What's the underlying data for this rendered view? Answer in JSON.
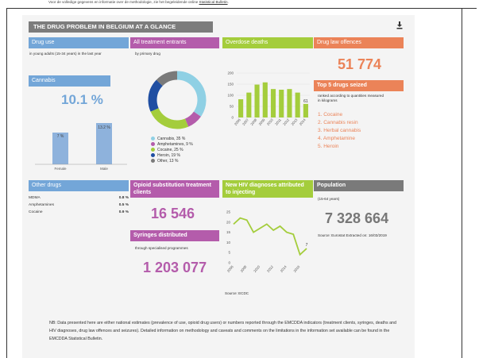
{
  "top_note": {
    "text": "Voor de volledige gegevens en informatie over de methodologie, zie het begeleidende online",
    "link": "Statistical Bulletin",
    "end": "."
  },
  "title": "THE DRUG PROBLEM IN BELGIUM AT A GLANCE",
  "drug_use": {
    "header": "Drug use",
    "subtitle": "in young adults (15-34 years) in the last year",
    "cannabis_label": "Cannabis",
    "cannabis_value": "10.1 %",
    "bars": [
      {
        "label": "Female",
        "value": "7 %",
        "num": 7.0
      },
      {
        "label": "Male",
        "value": "13.2 %",
        "num": 13.2
      }
    ]
  },
  "treatment": {
    "header": "All treatment entrants",
    "subtitle": "by primary drug",
    "legend": [
      {
        "label": "Cannabis, 35 %",
        "value": 35,
        "color": "#8fd0e4"
      },
      {
        "label": "Amphetamines, 9 %",
        "value": 9,
        "color": "#b45cab"
      },
      {
        "label": "Cocaine, 25 %",
        "value": 25,
        "color": "#a4cd3c"
      },
      {
        "label": "Heroin, 19 %",
        "value": 19,
        "color": "#1f4ea2"
      },
      {
        "label": "Other, 13 %",
        "value": 13,
        "color": "#7a7a7a"
      }
    ]
  },
  "overdose": {
    "header": "Overdose deaths",
    "yticks": [
      "200",
      "150",
      "100",
      "50",
      "0"
    ],
    "years": [
      "2006",
      "2007",
      "2008",
      "2009",
      "2010",
      "2011",
      "2012",
      "2013",
      "2014"
    ],
    "values": [
      82,
      112,
      148,
      158,
      128,
      125,
      128,
      112,
      61
    ],
    "last_label": "61"
  },
  "drug_law": {
    "header": "Drug law offences",
    "value": "51 774"
  },
  "seized": {
    "header": "Top 5 drugs seized",
    "subtitle": "ranked according to quantities measured in kilograms",
    "items": [
      "1. Cocaine",
      "2. Cannabis resin",
      "3. Herbal cannabis",
      "4. Amphetamine",
      "5. Heroin"
    ]
  },
  "other_drugs": {
    "header": "Other drugs",
    "rows": [
      {
        "name": "MDMA",
        "value": "0.8 %"
      },
      {
        "name": "Amphetamines",
        "value": "0.5 %"
      },
      {
        "name": "Cocaine",
        "value": "0.9 %"
      }
    ]
  },
  "opioid": {
    "header_line1": "Opioid substitution treatment",
    "header_line2": "clients",
    "value": "16 546"
  },
  "syringes": {
    "header": "Syringes distributed",
    "subtitle": "through specialised programmes",
    "value": "1 203 077"
  },
  "hiv": {
    "header_line1": "New HIV diagnoses attributed",
    "header_line2": "to injecting",
    "yticks": [
      "25",
      "20",
      "15",
      "10",
      "5",
      "0"
    ],
    "xticks": [
      "2006",
      "2008",
      "2010",
      "2012",
      "2014",
      "2016"
    ],
    "values": [
      19,
      22,
      21,
      15,
      17,
      19,
      16,
      18,
      15,
      14,
      4,
      7
    ],
    "last_label": "7",
    "source": "Source: ECDC"
  },
  "population": {
    "header": "Population",
    "subtitle": "(15-64 years)",
    "value": "7 328 664",
    "source": "Source: Eurostat Extracted on: 16/03/2019"
  },
  "footnote": "NB: Data presented here are either national estimates (prevalence of use, opioid drug users) or numbers reported through the EMCDDA indicators (treatment clients, syringes, deaths and HIV diagnoses, drug law offences and seizures). Detailed information on methodology and caveats and comments on the limitations in the information set available can be found in the EMCDDA Statistical Bulletin.",
  "chart_data": [
    {
      "type": "bar",
      "categories": [
        "Female",
        "Male"
      ],
      "values": [
        7,
        13.2
      ],
      "title": "Cannabis"
    },
    {
      "type": "pie",
      "categories": [
        "Cannabis",
        "Amphetamines",
        "Cocaine",
        "Heroin",
        "Other"
      ],
      "values": [
        35,
        9,
        25,
        19,
        13
      ],
      "title": "All treatment entrants"
    },
    {
      "type": "bar",
      "categories": [
        "2006",
        "2007",
        "2008",
        "2009",
        "2010",
        "2011",
        "2012",
        "2013",
        "2014"
      ],
      "values": [
        82,
        112,
        148,
        158,
        128,
        125,
        128,
        112,
        61
      ],
      "ylim": [
        0,
        200
      ],
      "title": "Overdose deaths"
    },
    {
      "type": "line",
      "x": [
        2006,
        2007,
        2008,
        2009,
        2010,
        2011,
        2012,
        2013,
        2014,
        2015,
        2016,
        2017
      ],
      "values": [
        19,
        22,
        21,
        15,
        17,
        19,
        16,
        18,
        15,
        14,
        4,
        7
      ],
      "ylim": [
        0,
        25
      ],
      "title": "New HIV diagnoses attributed to injecting"
    }
  ]
}
